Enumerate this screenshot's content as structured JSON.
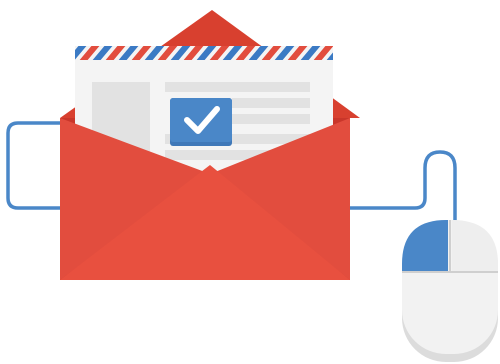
{
  "illustration": {
    "icons": {
      "envelope": "envelope-icon",
      "letter": "letter-icon",
      "checkmark": "checkmark-icon",
      "mouse": "computer-mouse-icon",
      "cable": "cable-icon"
    },
    "colors": {
      "envelope_red": "#e24d3e",
      "envelope_dark_red": "#c9362a",
      "envelope_flap_red": "#d8402f",
      "letter_paper": "#f4f4f4",
      "letter_lines": "#e2e2e2",
      "stripe_red": "#e24d3e",
      "stripe_blue": "#3b7ac4",
      "check_blue": "#4a87c8",
      "cable_blue": "#4a87c8",
      "mouse_body": "#f2f2f2",
      "mouse_shadow": "#dcdcdc",
      "mouse_button_blue": "#4a87c8"
    }
  }
}
